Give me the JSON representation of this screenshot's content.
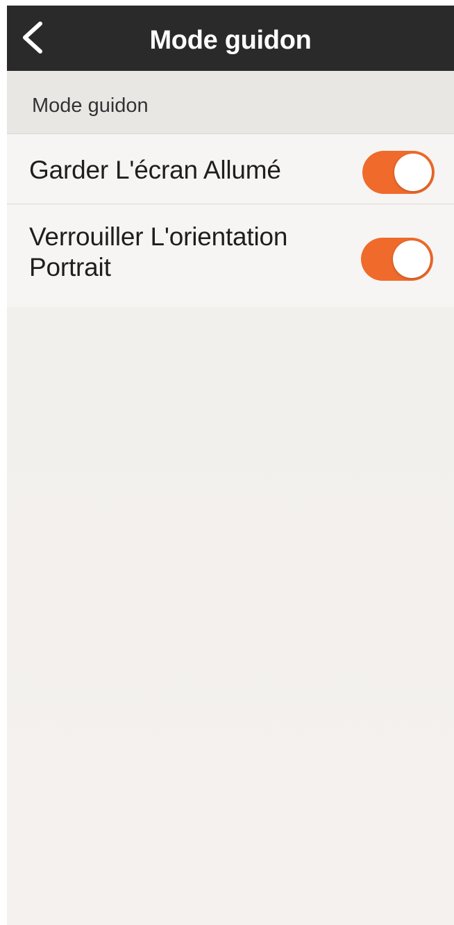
{
  "header": {
    "title": "Mode guidon",
    "back_icon": "chevron-left-icon"
  },
  "section": {
    "label": "Mode guidon"
  },
  "settings": [
    {
      "label": "Garder L'écran Allumé",
      "enabled": true
    },
    {
      "label": "Verrouiller L'orientation Portrait",
      "enabled": true
    }
  ],
  "colors": {
    "navbar": "#2a2a2a",
    "toggle_on": "#ef6a2b",
    "background": "#f2f0ed"
  }
}
